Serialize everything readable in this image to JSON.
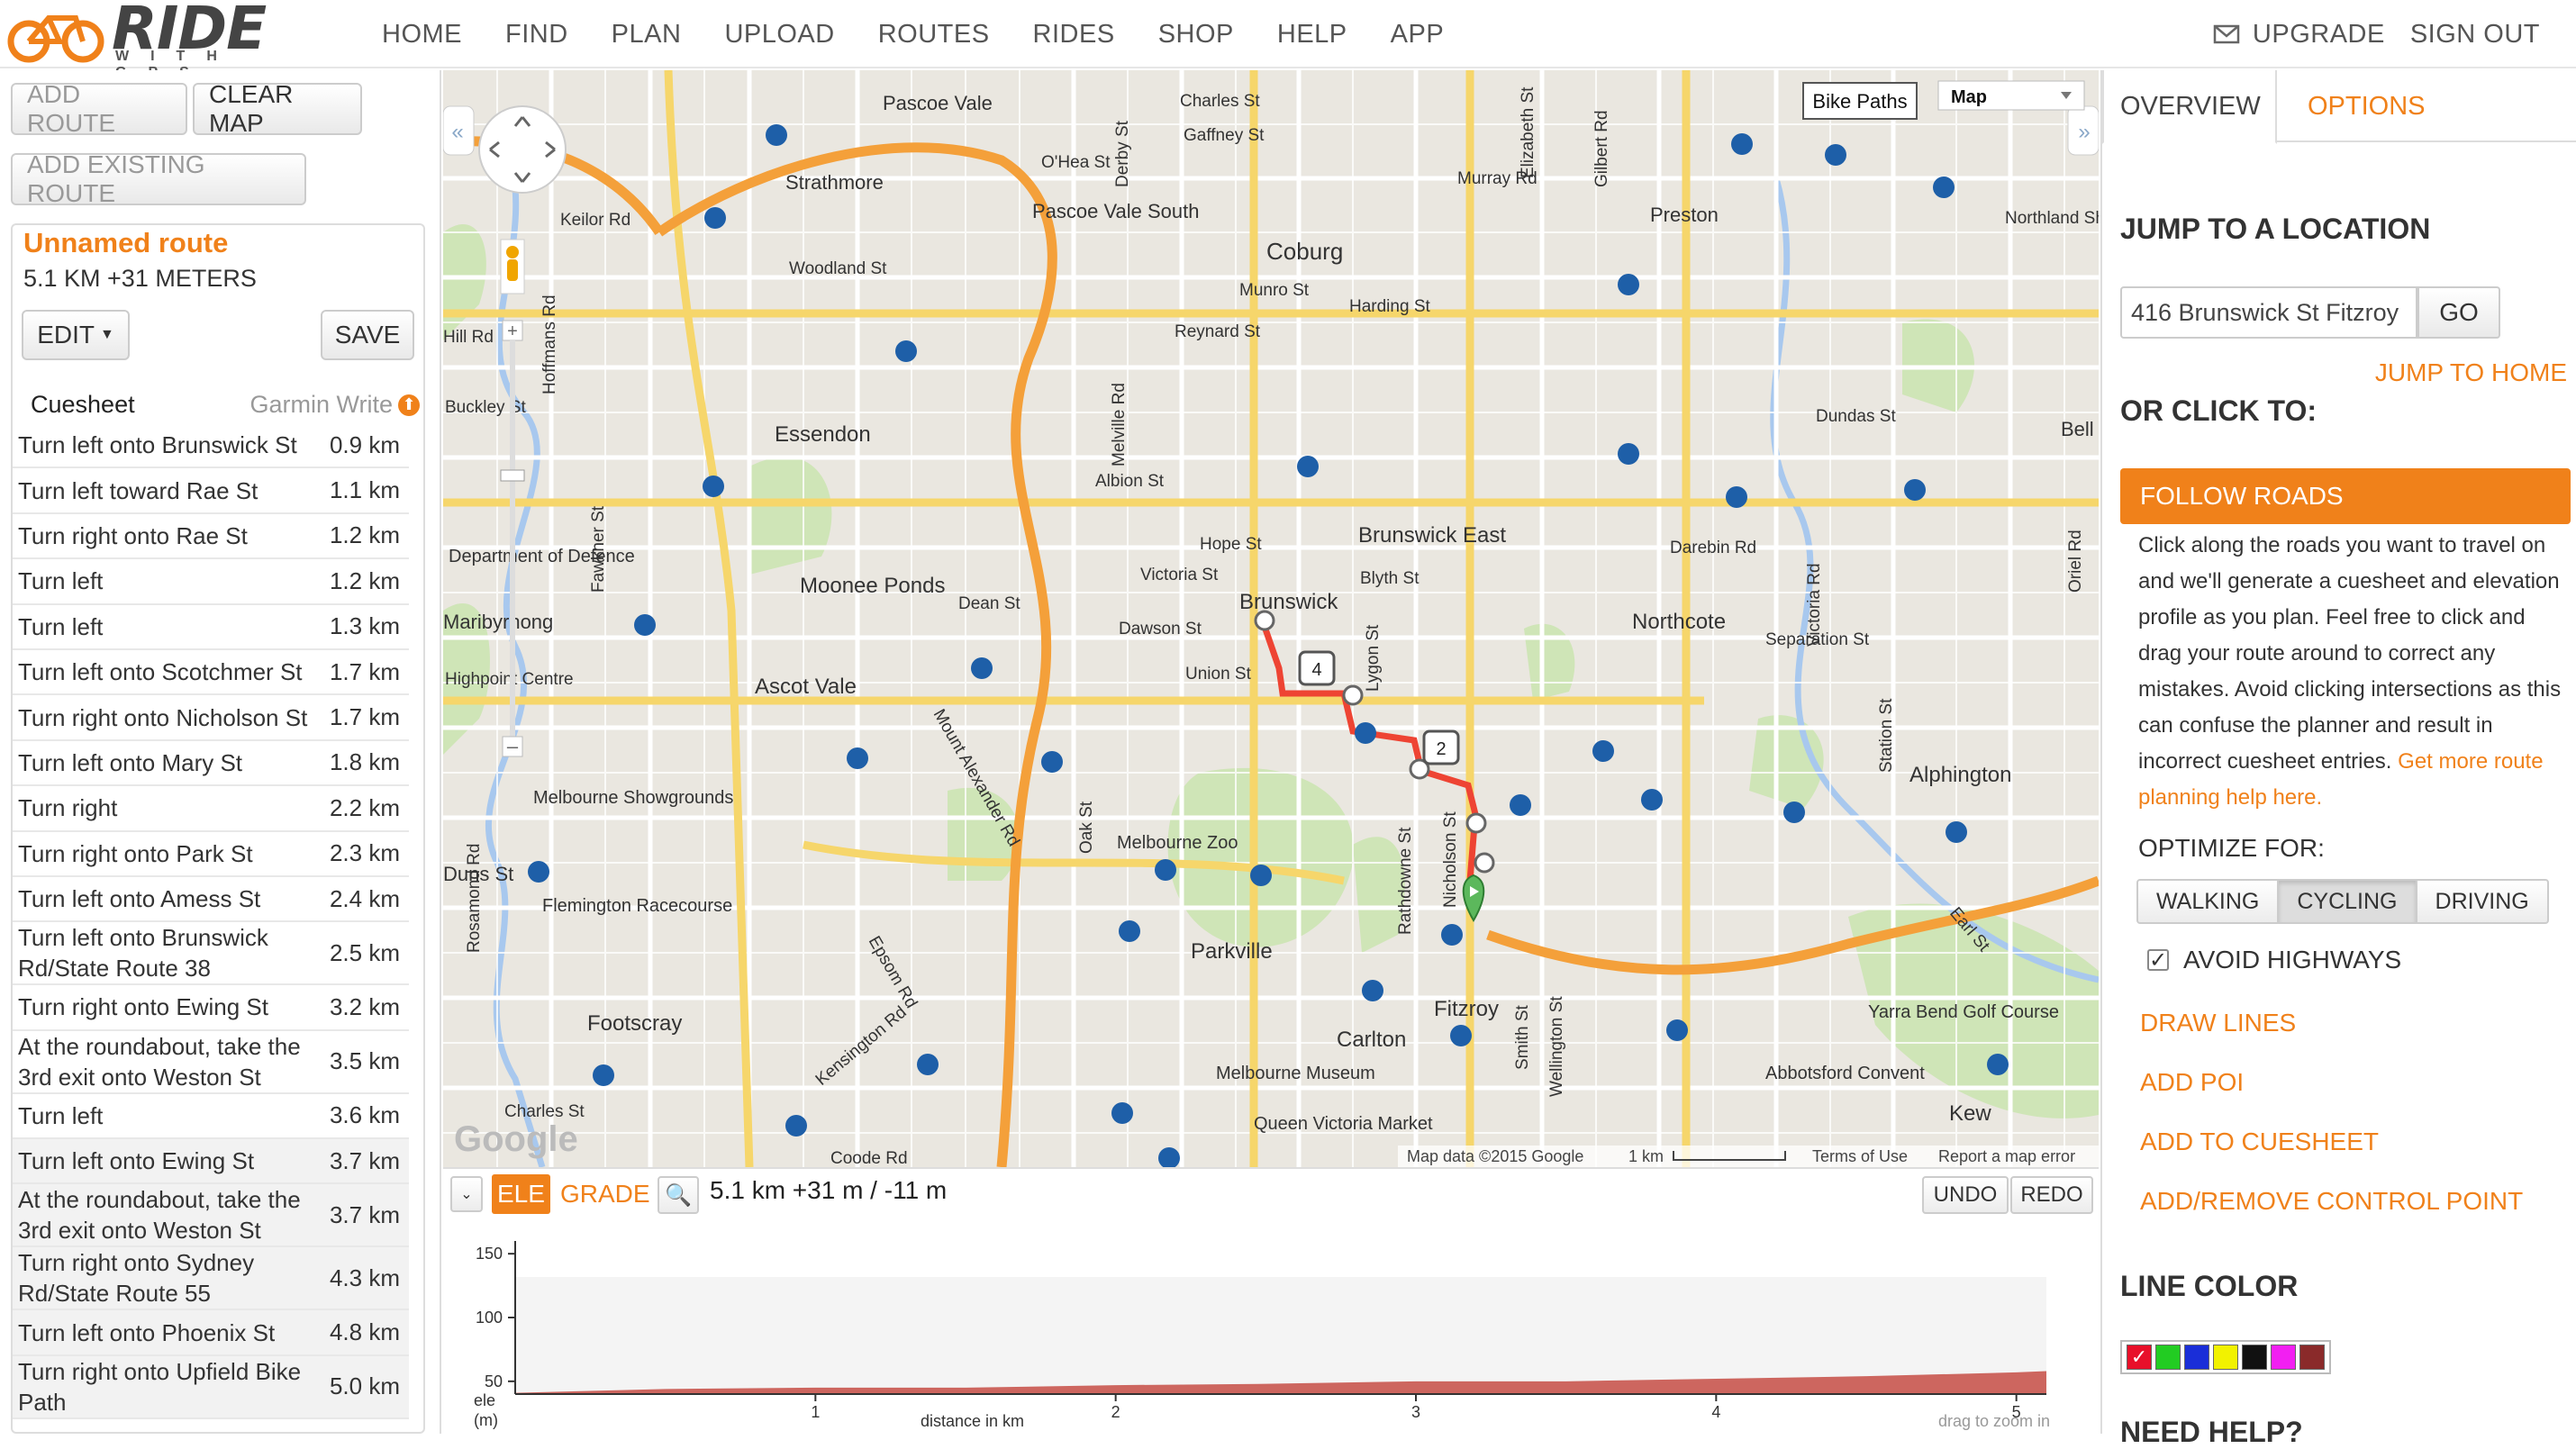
{
  "header": {
    "logo_text": "RIDE",
    "logo_sub": "WITH GPS",
    "nav": [
      "HOME",
      "FIND",
      "PLAN",
      "UPLOAD",
      "ROUTES",
      "RIDES",
      "SHOP",
      "HELP",
      "APP"
    ],
    "upgrade": "UPGRADE",
    "signout": "SIGN OUT"
  },
  "left": {
    "add_route": "ADD ROUTE",
    "clear_map": "CLEAR MAP",
    "add_existing": "ADD EXISTING ROUTE",
    "route_name": "Unnamed route",
    "route_stats": "5.1 KM +31 METERS",
    "edit": "EDIT",
    "save": "SAVE",
    "cuesheet_title": "Cuesheet",
    "garmin": "Garmin Write",
    "cues": [
      {
        "text": "Turn left onto Brunswick St",
        "dist": "0.9 km"
      },
      {
        "text": "Turn left toward Rae St",
        "dist": "1.1 km"
      },
      {
        "text": "Turn right onto Rae St",
        "dist": "1.2 km"
      },
      {
        "text": "Turn left",
        "dist": "1.2 km"
      },
      {
        "text": "Turn left",
        "dist": "1.3 km"
      },
      {
        "text": "Turn left onto Scotchmer St",
        "dist": "1.7 km"
      },
      {
        "text": "Turn right onto Nicholson St",
        "dist": "1.7 km"
      },
      {
        "text": "Turn left onto Mary St",
        "dist": "1.8 km"
      },
      {
        "text": "Turn right",
        "dist": "2.2 km"
      },
      {
        "text": "Turn right onto Park St",
        "dist": "2.3 km"
      },
      {
        "text": "Turn left onto Amess St",
        "dist": "2.4 km"
      },
      {
        "text": "Turn left onto Brunswick Rd/State Route 38",
        "dist": "2.5 km"
      },
      {
        "text": "Turn right onto Ewing St",
        "dist": "3.2 km"
      },
      {
        "text": "At the roundabout, take the 3rd exit onto Weston St",
        "dist": "3.5 km"
      },
      {
        "text": "Turn left",
        "dist": "3.6 km"
      },
      {
        "text": "Turn left onto Ewing St",
        "dist": "3.7 km"
      },
      {
        "text": "At the roundabout, take the 3rd exit onto Weston St",
        "dist": "3.7 km"
      },
      {
        "text": "Turn right onto Sydney Rd/State Route 55",
        "dist": "4.3 km"
      },
      {
        "text": "Turn left onto Phoenix St",
        "dist": "4.8 km"
      },
      {
        "text": "Turn right onto Upfield Bike Path",
        "dist": "5.0 km"
      }
    ]
  },
  "map": {
    "layer_toggle": "Bike Paths",
    "map_type": "Map",
    "attribution": "Map data ©2015 Google",
    "scale": "1 km",
    "terms": "Terms of Use",
    "report": "Report a map error",
    "google": "Google",
    "places": [
      "Pascoe Vale",
      "Charles St",
      "Gaffney St",
      "Strathmore",
      "O'Hea St",
      "Pascoe Vale South",
      "Coburg",
      "Murray Rd",
      "Preston",
      "Northland Shopping",
      "Woodland St",
      "Keilor Rd",
      "Harding St",
      "Reynard St",
      "Munro St",
      "Essendon",
      "Albion St",
      "Dundas St",
      "Bell",
      "Brunswick East",
      "Hope St",
      "Victoria St",
      "Blyth St",
      "Brunswick",
      "Darebin Rd",
      "Moonee Ponds",
      "Dean St",
      "Dawson St",
      "Northcote",
      "Separation St",
      "Department of Defence",
      "Maribyrnong",
      "Ascot Vale",
      "Union St",
      "Alphington",
      "Melbourne Showgrounds",
      "Melbourne Zoo",
      "Flemington Racecourse",
      "Parkville",
      "Fitzroy",
      "Carlton",
      "Yarra Bend Golf Course",
      "Footscray",
      "Melbourne Museum",
      "Abbotsford Convent",
      "Kew",
      "Queen Victoria Market",
      "Charles St",
      "Coode Rd",
      "Highpoint Centre",
      "Kensington Rd",
      "Epsom Rd",
      "Mount Alexander Rd",
      "Nicholson St",
      "Lygon St",
      "Rathdowne St",
      "Smith St",
      "Wellington St",
      "Earl St",
      "Station St",
      "Victoria Rd",
      "Oriel Rd",
      "Fawkner St",
      "Hoffmans Rd",
      "Buckley St",
      "Rosamond Rd",
      "Melville Rd",
      "Derby St",
      "Elizabeth St",
      "Gilbert Rd",
      "Oak St",
      "Duns St",
      "Hill Rd"
    ],
    "markers": [
      "4",
      "2"
    ]
  },
  "elevation": {
    "ele_tab": "ELE",
    "grade_tab": "GRADE",
    "stats": "5.1 km +31 m / -11 m",
    "undo": "UNDO",
    "redo": "REDO",
    "y_ticks": [
      "150",
      "100",
      "50"
    ],
    "x_ticks": [
      "1",
      "2",
      "3",
      "4",
      "5"
    ],
    "y_label": "ele (m)",
    "x_label": "distance in km",
    "hint": "drag to zoom in",
    "chart_data": {
      "type": "area",
      "x": [
        0,
        0.5,
        1,
        1.5,
        2,
        2.5,
        3,
        3.5,
        4,
        4.5,
        5,
        5.1
      ],
      "y": [
        41,
        44,
        45,
        45,
        47,
        48,
        50,
        50,
        52,
        54,
        57,
        58
      ],
      "ylim": [
        40,
        160
      ],
      "xlim": [
        0,
        5.1
      ]
    }
  },
  "right": {
    "tab_overview": "OVERVIEW",
    "tab_options": "OPTIONS",
    "jump_title": "JUMP TO A LOCATION",
    "location_value": "416 Brunswick St Fitzroy",
    "go": "GO",
    "jump_home": "JUMP TO HOME",
    "click_title": "OR CLICK TO:",
    "follow_roads": "FOLLOW ROADS",
    "follow_desc": "Click along the roads you want to travel on and we'll generate a cuesheet and elevation profile as you plan. Feel free to click and drag your route around to correct any mistakes. Avoid clicking intersections as this can confuse the planner and result in incorrect cuesheet entries.",
    "follow_link": "Get more route planning help here.",
    "optimize_title": "OPTIMIZE FOR:",
    "optimize": [
      "WALKING",
      "CYCLING",
      "DRIVING"
    ],
    "avoid_highways": "AVOID HIGHWAYS",
    "draw_lines": "DRAW LINES",
    "add_poi": "ADD POI",
    "add_cuesheet": "ADD TO CUESHEET",
    "add_control": "ADD/REMOVE CONTROL POINT",
    "line_color": "LINE COLOR",
    "need_help": "NEED HELP?",
    "colors": [
      "#e8102a",
      "#22cc22",
      "#1a2ed8",
      "#f2f200",
      "#111111",
      "#f21ff2",
      "#8a2a2a"
    ]
  }
}
